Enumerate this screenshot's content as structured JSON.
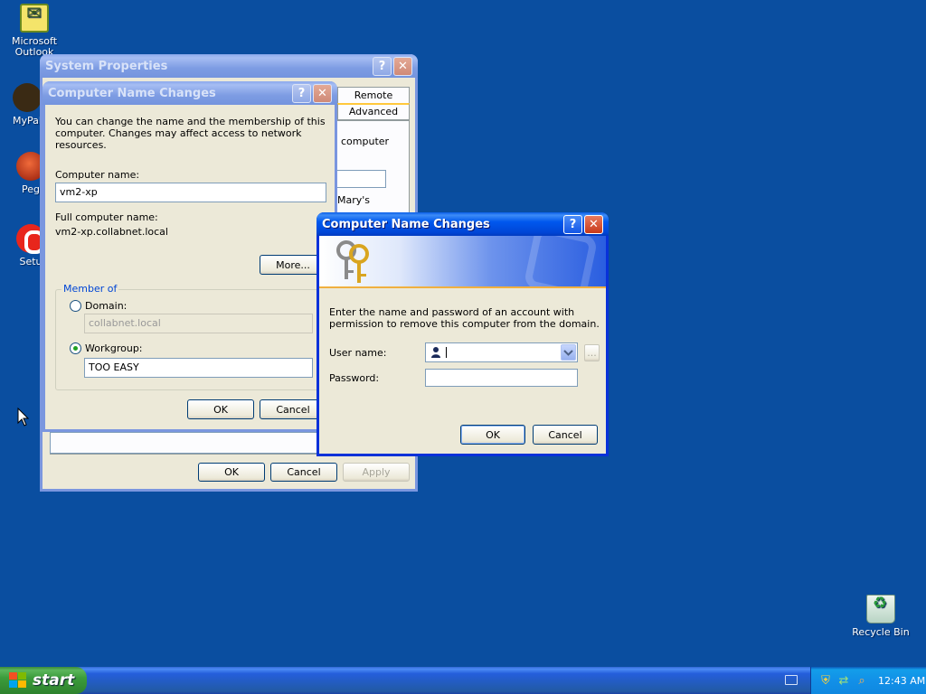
{
  "desktop": {
    "icons": [
      {
        "label": "Microsoft Outlook"
      },
      {
        "label": "MyPal"
      },
      {
        "label": "Peg"
      },
      {
        "label": "Setu"
      }
    ],
    "recycle_bin": "Recycle Bin"
  },
  "system_properties": {
    "title": "System Properties",
    "help": "?",
    "close": "✕",
    "tabs": [
      "Remote",
      "Advanced"
    ],
    "fragments": {
      "computer": "computer",
      "marys": "Mary's"
    },
    "ok": "OK",
    "cancel": "Cancel",
    "apply": "Apply"
  },
  "name_changes": {
    "title": "Computer Name Changes",
    "help": "?",
    "close": "✕",
    "intro": "You can change the name and the membership of this computer. Changes may affect access to network resources.",
    "computer_name_label": "Computer name:",
    "computer_name_value": "vm2-xp",
    "full_name_label": "Full computer name:",
    "full_name_value": "vm2-xp.collabnet.local",
    "more_button": "More...",
    "member_of_label": "Member of",
    "domain_label": "Domain:",
    "domain_value": "collabnet.local",
    "workgroup_label": "Workgroup:",
    "workgroup_value": "TOO EASY",
    "selected_membership": "Workgroup",
    "ok": "OK",
    "cancel": "Cancel"
  },
  "credentials": {
    "title": "Computer Name Changes",
    "help": "?",
    "close": "✕",
    "banner_icon": "keys-icon",
    "message": "Enter the name and password of an account with permission to remove this computer from the domain.",
    "user_name_label": "User name:",
    "user_name_value": "",
    "browse_button": "...",
    "password_label": "Password:",
    "password_value": "",
    "ok": "OK",
    "cancel": "Cancel"
  },
  "taskbar": {
    "start_label": "start",
    "clock": "12:43 AM",
    "tray_icons": [
      "keyboard-icon",
      "shield-icon",
      "network-icon",
      "search-icon"
    ]
  },
  "colors": {
    "desktop": "#0a4ea0",
    "title_active": "#0046d6",
    "title_inactive": "#7d9ce3",
    "dialog_face": "#ece9d8"
  }
}
